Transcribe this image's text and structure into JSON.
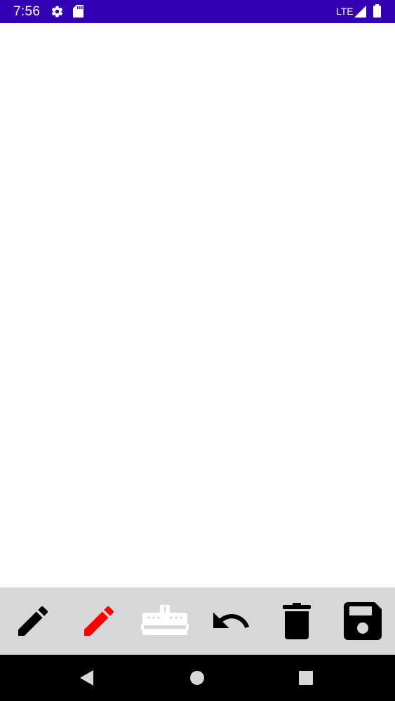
{
  "status_bar": {
    "time": "7:56",
    "network": "LTE",
    "background_color": "#3300b4",
    "icons": [
      "gear-icon",
      "sd-card-icon",
      "signal-icon",
      "battery-icon"
    ]
  },
  "canvas": {
    "background_color": "#ffffff"
  },
  "toolbar": {
    "background_color": "#d7d7d9",
    "tools": [
      {
        "icon": "pencil-icon",
        "color": "#000000"
      },
      {
        "icon": "pencil-icon",
        "color": "#ff0000"
      },
      {
        "icon": "eraser-icon",
        "color": "#ffffff"
      },
      {
        "icon": "undo-icon",
        "color": "#000000"
      },
      {
        "icon": "trash-icon",
        "color": "#000000"
      },
      {
        "icon": "save-icon",
        "color": "#000000"
      }
    ]
  },
  "nav_bar": {
    "background_color": "#000000",
    "buttons": [
      "back-icon",
      "home-icon",
      "recents-icon"
    ]
  }
}
